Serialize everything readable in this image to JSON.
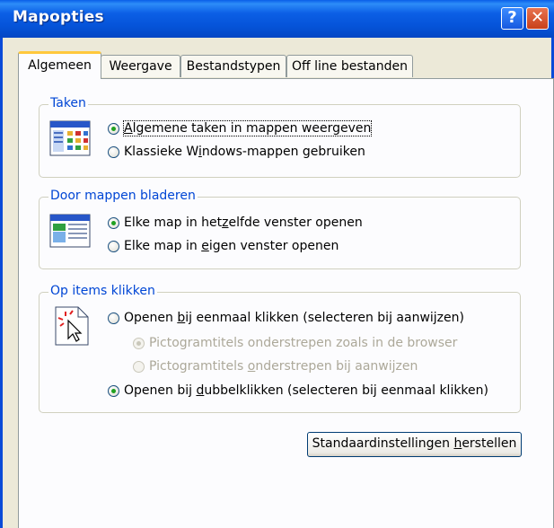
{
  "window": {
    "title": "Mapopties"
  },
  "titlebar_buttons": {
    "help": "?",
    "close": "✕"
  },
  "tabs": [
    {
      "label": "Algemeen",
      "active": true
    },
    {
      "label": "Weergave",
      "active": false
    },
    {
      "label": "Bestandstypen",
      "active": false
    },
    {
      "label": "Off line bestanden",
      "active": false
    }
  ],
  "groups": {
    "tasks": {
      "title": "Taken",
      "icon": "task-pane-folder-icon",
      "options": [
        {
          "pre": "",
          "u": "A",
          "post": "lgemene taken in mappen weergeven",
          "checked": true
        },
        {
          "pre": "Klassieke W",
          "u": "i",
          "post": "ndows-mappen gebruiken",
          "checked": false
        }
      ]
    },
    "browse": {
      "title": "Door mappen bladeren",
      "icon": "same-window-icon",
      "options": [
        {
          "pre": "Elke map in het",
          "u": "z",
          "post": "elfde venster openen",
          "checked": true
        },
        {
          "pre": "Elke map in ",
          "u": "e",
          "post": "igen venster openen",
          "checked": false
        }
      ]
    },
    "click": {
      "title": "Op items klikken",
      "icon": "click-pointer-icon",
      "options": [
        {
          "pre": "Openen ",
          "u": "b",
          "post": "ij eenmaal klikken (selecteren bij aanwijzen)",
          "checked": false,
          "disabled": false
        },
        {
          "pre": "Pictogramtitels onderstrepen zoals in de ",
          "u": "",
          "post": "browser",
          "checked": true,
          "disabled": true
        },
        {
          "pre": "Pictogramtitels ",
          "u": "o",
          "post": "nderstrepen bij aanwijzen",
          "checked": false,
          "disabled": true
        },
        {
          "pre": "Openen bij ",
          "u": "d",
          "post": "ubbelklikken (selecteren bij eenmaal klikken)",
          "checked": true,
          "disabled": false
        }
      ]
    }
  },
  "restore_button": {
    "pre": "Standaardinstellingen ",
    "u": "h",
    "post": "erstellen"
  }
}
